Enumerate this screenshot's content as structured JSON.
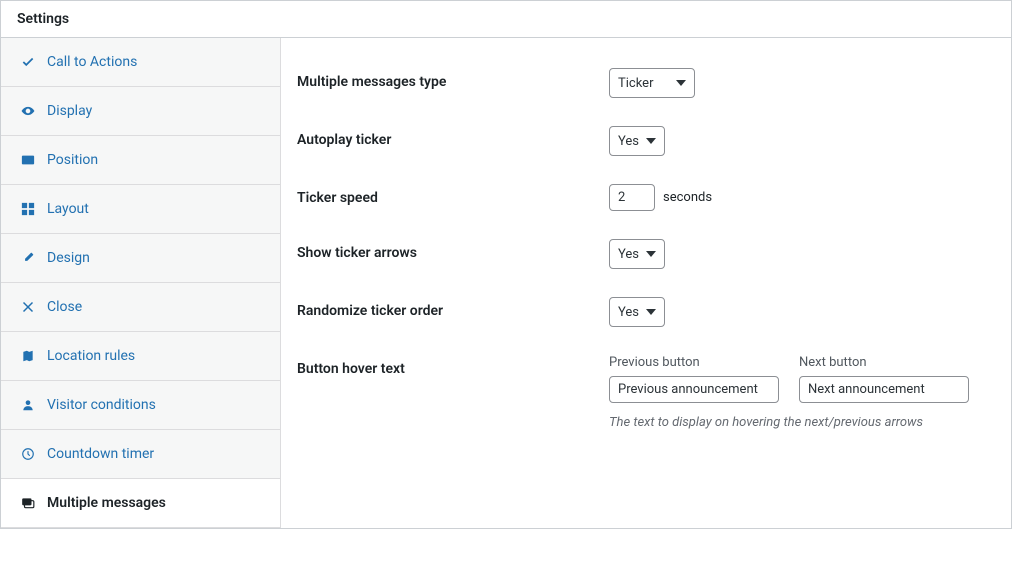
{
  "header": {
    "title": "Settings"
  },
  "sidebar": {
    "items": [
      {
        "label": "Call to Actions"
      },
      {
        "label": "Display"
      },
      {
        "label": "Position"
      },
      {
        "label": "Layout"
      },
      {
        "label": "Design"
      },
      {
        "label": "Close"
      },
      {
        "label": "Location rules"
      },
      {
        "label": "Visitor conditions"
      },
      {
        "label": "Countdown timer"
      },
      {
        "label": "Multiple messages"
      }
    ]
  },
  "form": {
    "messages_type": {
      "label": "Multiple messages type",
      "value": "Ticker"
    },
    "autoplay": {
      "label": "Autoplay ticker",
      "value": "Yes"
    },
    "ticker_speed": {
      "label": "Ticker speed",
      "value": "2",
      "unit": "seconds"
    },
    "show_arrows": {
      "label": "Show ticker arrows",
      "value": "Yes"
    },
    "randomize": {
      "label": "Randomize ticker order",
      "value": "Yes"
    },
    "hover_text": {
      "label": "Button hover text",
      "previous_label": "Previous button",
      "previous_value": "Previous announcement",
      "next_label": "Next button",
      "next_value": "Next announcement",
      "help": "The text to display on hovering the next/previous arrows"
    }
  }
}
